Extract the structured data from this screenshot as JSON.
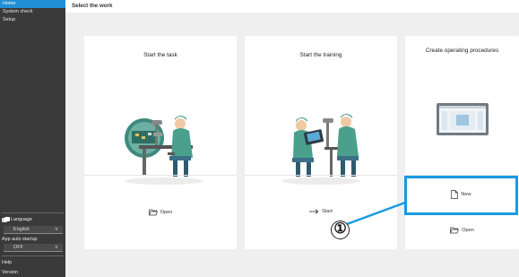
{
  "sidebar": {
    "items": [
      {
        "label": "Home",
        "active": true
      },
      {
        "label": "System check",
        "active": false
      },
      {
        "label": "Setup",
        "active": false
      }
    ],
    "language_label": "Language",
    "language_value": "English",
    "auto_startup_label": "App auto startup",
    "auto_startup_value": "OFF",
    "help_label": "Help",
    "version_label": "Version"
  },
  "header": {
    "title": "Select the work"
  },
  "cards": [
    {
      "title": "Start the task",
      "action": "Open",
      "action_icon": "folder-open-icon"
    },
    {
      "title": "Start the training",
      "action": "Start",
      "action_icon": "arrow-right-icon"
    },
    {
      "title": "Create operating procedures",
      "action_new": "New",
      "action_new_icon": "file-icon",
      "action_open": "Open",
      "action_open_icon": "folder-open-icon"
    }
  ],
  "annotation": {
    "number": "①"
  },
  "colors": {
    "accent": "#1f8fd6",
    "highlight": "#169be0",
    "sidebar": "#3a3a3a",
    "background": "#efefef"
  }
}
